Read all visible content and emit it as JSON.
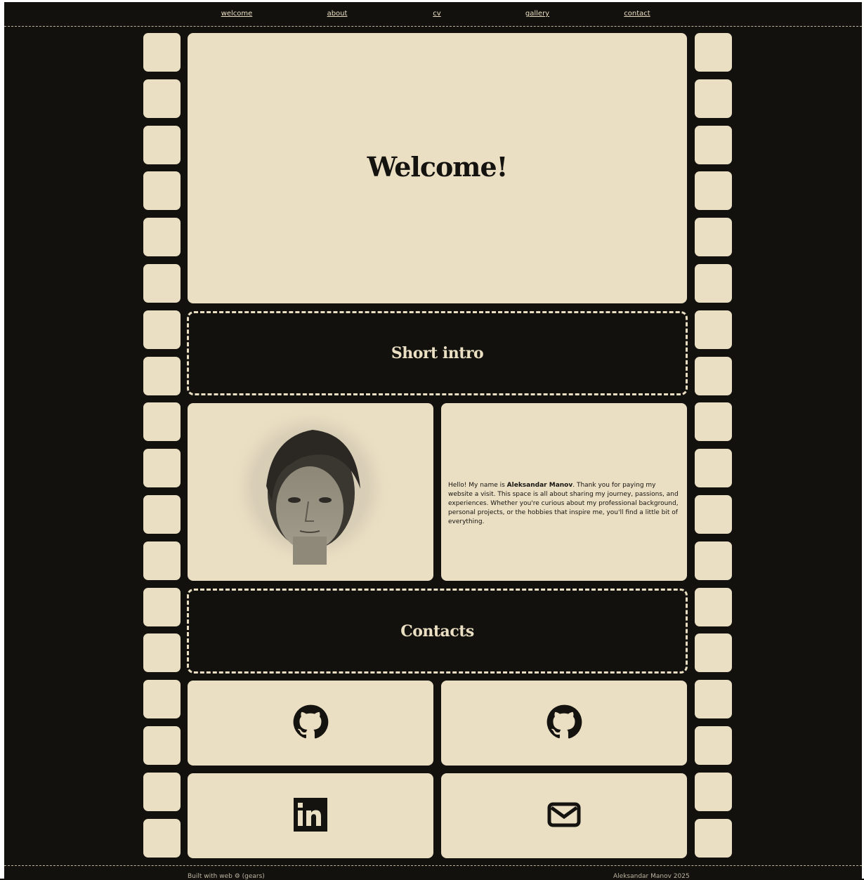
{
  "nav": {
    "items": [
      "welcome",
      "about",
      "cv",
      "gallery",
      "contact"
    ]
  },
  "hero": {
    "title": "Welcome!"
  },
  "sections": {
    "intro_heading": "Short intro",
    "contacts_heading": "Contacts"
  },
  "intro": {
    "text_before": "Hello! My name is ",
    "name": "Aleksandar Manov",
    "text_after": ". Thank you for paying my website a visit. This space is all about sharing my journey, passions, and experiences. Whether you're curious about my professional background, personal projects, or the hobbies that inspire me, you'll find a little bit of everything."
  },
  "contacts": {
    "icons": [
      "github-icon",
      "github-icon",
      "linkedin-icon",
      "mail-icon"
    ]
  },
  "footer": {
    "built_with": "Built with web ⚙ (gears)",
    "copyright": "Aleksandar Manov 2025"
  },
  "colors": {
    "background": "#12110e",
    "cream": "#ebdfc3",
    "ink": "#151310"
  }
}
